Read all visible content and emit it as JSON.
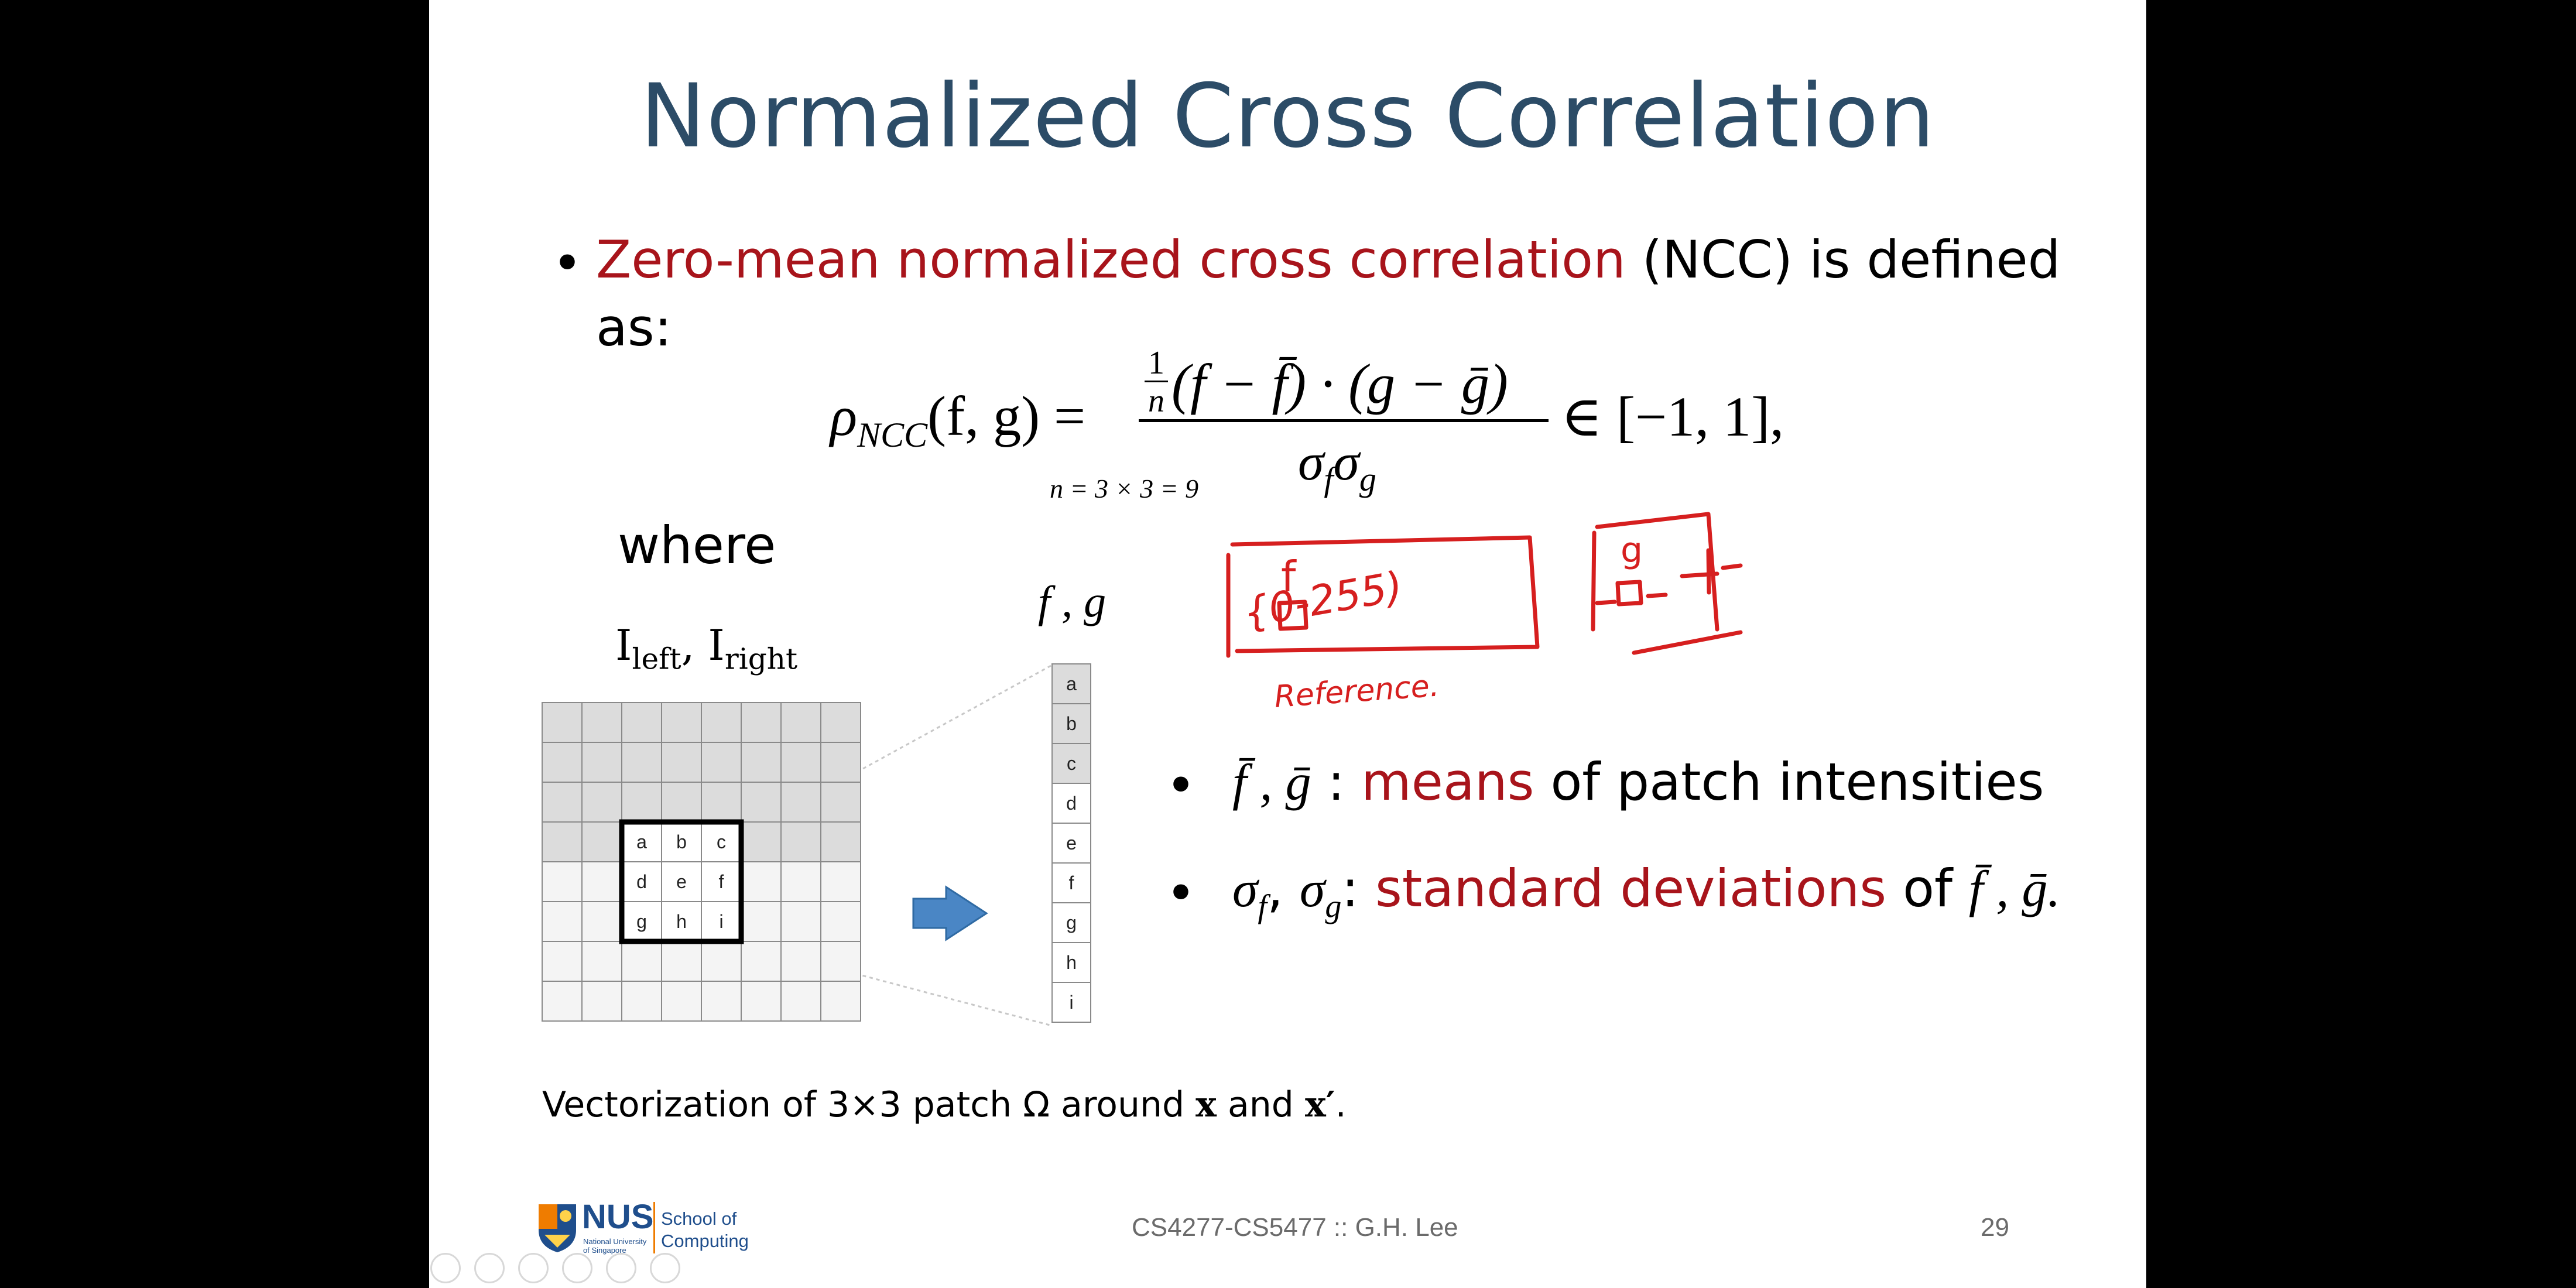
{
  "slide": {
    "title": "Normalized Cross Correlation",
    "bullet1": {
      "highlight": "Zero-mean normalized cross correlation",
      "rest": " (NCC) is defined",
      "cont": "as:"
    },
    "formula": {
      "lhs": "ρ",
      "lhs_sub": "NCC",
      "lhs_args": "(f, g) =",
      "frac_coef_num": "1",
      "frac_coef_den": "n",
      "numerator": "(f − f̄) · (g − ḡ)",
      "denominator": "σ",
      "den_f": "f",
      "den_sigma2": "σ",
      "den_g": "g",
      "rhs": "∈ [−1, 1],",
      "n_annotation": "n =  3  × 3 = 9"
    },
    "where_label": "where",
    "image_labels": {
      "i_left": "I",
      "left_sub": "left",
      "comma": ", ",
      "i_right": "I",
      "right_sub": "right",
      "fg_label": "f , g"
    },
    "grid": {
      "patch_letters": [
        "a",
        "b",
        "c",
        "d",
        "e",
        "f",
        "g",
        "h",
        "i"
      ],
      "vector_letters": [
        "a",
        "b",
        "c",
        "d",
        "e",
        "f",
        "g",
        "h",
        "i"
      ]
    },
    "bullet2": {
      "symbols": "f̄ , ḡ",
      "colon": " : ",
      "highlight": "means",
      "rest": " of patch intensities"
    },
    "bullet3": {
      "sigma_f": "σ",
      "sub_f": "f",
      "comma": ", ",
      "sigma_g": "σ",
      "sub_g": "g",
      "colon": ": ",
      "highlight": "standard deviations",
      "rest": " of ",
      "tail": "f̄ , ḡ."
    },
    "caption": {
      "pre": "Vectorization of 3×3 patch Ω around ",
      "x": "x",
      "mid": " and ",
      "xp": "x′",
      "end": "."
    },
    "annotations": {
      "range": "{0-255)",
      "f_box_label": "f",
      "g_box_label": "g",
      "reference": "Reference."
    },
    "footer": {
      "logo_text": "NUS",
      "logo_subtext": "National University of Singapore",
      "school_line1": "School of",
      "school_line2": "Computing",
      "course": "CS4277-CS5477 :: G.H. Lee",
      "page_number": "29"
    }
  },
  "colors": {
    "title": "#2c4c67",
    "highlight_red": "#a8141b",
    "handwriting_red": "#d61f1f",
    "arrow_blue": "#4a86c5",
    "nus_blue": "#1f4e8c",
    "nus_orange": "#ef7c00"
  }
}
